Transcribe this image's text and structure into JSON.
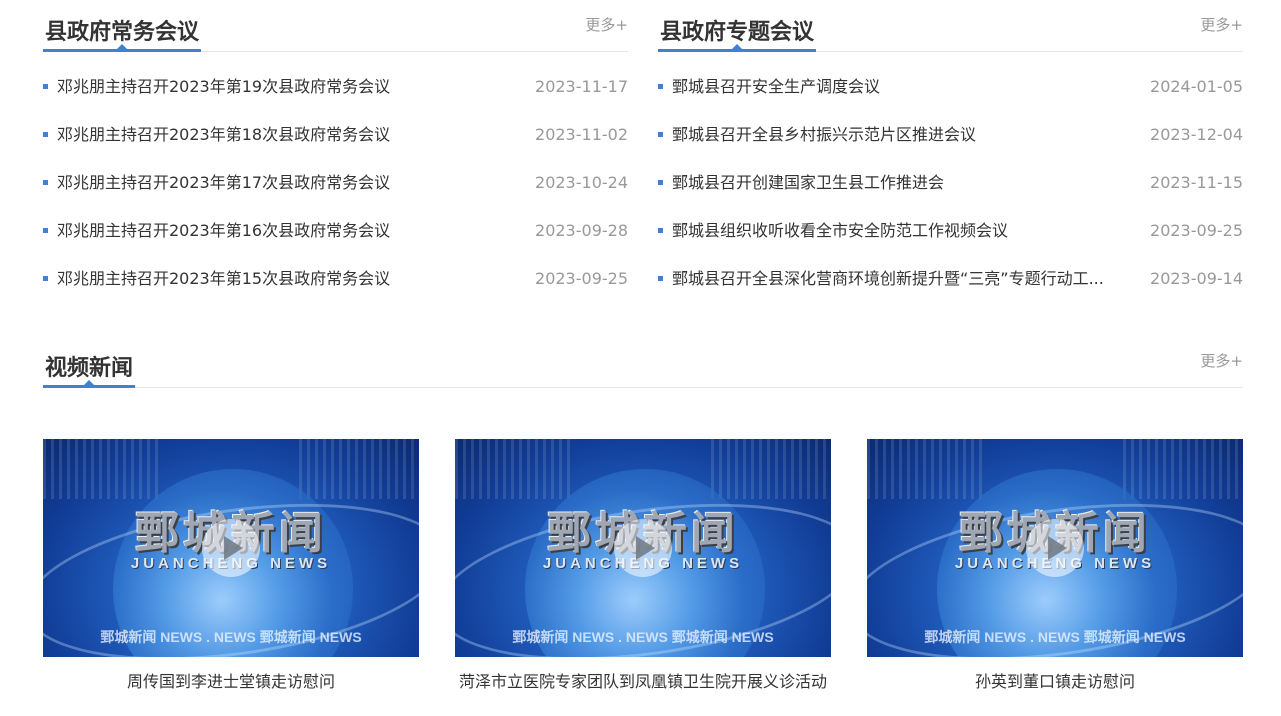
{
  "panels": {
    "executive_meetings": {
      "title": "县政府常务会议",
      "more": "更多+",
      "items": [
        {
          "title": "邓兆朋主持召开2023年第19次县政府常务会议",
          "date": "2023-11-17"
        },
        {
          "title": "邓兆朋主持召开2023年第18次县政府常务会议",
          "date": "2023-11-02"
        },
        {
          "title": "邓兆朋主持召开2023年第17次县政府常务会议",
          "date": "2023-10-24"
        },
        {
          "title": "邓兆朋主持召开2023年第16次县政府常务会议",
          "date": "2023-09-28"
        },
        {
          "title": "邓兆朋主持召开2023年第15次县政府常务会议",
          "date": "2023-09-25"
        }
      ]
    },
    "special_meetings": {
      "title": "县政府专题会议",
      "more": "更多+",
      "items": [
        {
          "title": "鄄城县召开安全生产调度会议",
          "date": "2024-01-05"
        },
        {
          "title": "鄄城县召开全县乡村振兴示范片区推进会议",
          "date": "2023-12-04"
        },
        {
          "title": "鄄城县召开创建国家卫生县工作推进会",
          "date": "2023-11-15"
        },
        {
          "title": "鄄城县组织收听收看全市安全防范工作视频会议",
          "date": "2023-09-25"
        },
        {
          "title": "鄄城县召开全县深化营商环境创新提升暨“三亮”专题行动工...",
          "date": "2023-09-14"
        }
      ]
    }
  },
  "video_news": {
    "title": "视频新闻",
    "more": "更多+",
    "thumbnail": {
      "brand": "鄄城新闻",
      "brand_en": "JUANCHENG NEWS",
      "ticker": "鄄城新闻 NEWS . NEWS 鄄城新闻 NEWS"
    },
    "items": [
      {
        "caption": "周传国到李进士堂镇走访慰问"
      },
      {
        "caption": "菏泽市立医院专家团队到凤凰镇卫生院开展义诊活动"
      },
      {
        "caption": "孙英到董口镇走访慰问"
      }
    ]
  },
  "colors": {
    "accent": "#3f82d1",
    "text": "#333333",
    "muted": "#999999",
    "divider": "#e6e6e6"
  }
}
